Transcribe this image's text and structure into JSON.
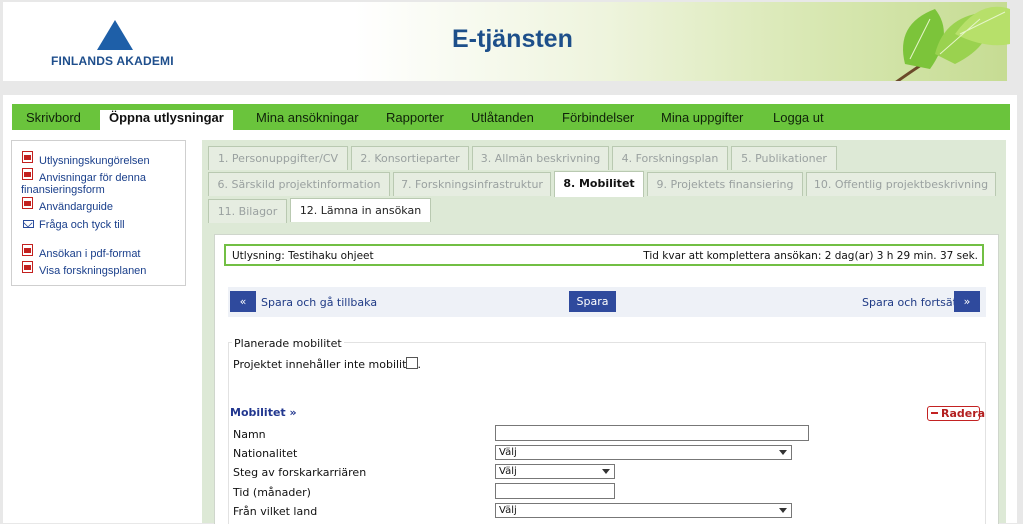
{
  "header": {
    "logo_text": "FINLANDS AKADEMI",
    "app_title": "E-tjänsten"
  },
  "nav": {
    "items": [
      {
        "label": "Skrivbord"
      },
      {
        "label": "Öppna utlysningar"
      },
      {
        "label": "Mina ansökningar"
      },
      {
        "label": "Rapporter"
      },
      {
        "label": "Utlåtanden"
      },
      {
        "label": "Förbindelser"
      },
      {
        "label": "Mina uppgifter"
      },
      {
        "label": "Logga ut"
      }
    ],
    "active_index": 1
  },
  "sidebar": {
    "links": [
      {
        "label": "Utlysningskungörelsen",
        "icon": "pdf-icon"
      },
      {
        "label": "Anvisningar för denna",
        "label2": "finansieringsform",
        "icon": "pdf-icon"
      },
      {
        "label": "Användarguide",
        "icon": "pdf-icon"
      },
      {
        "label": "Fråga och tyck till",
        "icon": "mail-icon"
      },
      {
        "label": "Ansökan i pdf-format",
        "icon": "pdf-icon"
      },
      {
        "label": "Visa forskningsplanen",
        "icon": "pdf-icon"
      }
    ]
  },
  "tabs": [
    {
      "label": "1. Personuppgifter/CV"
    },
    {
      "label": "2. Konsortieparter"
    },
    {
      "label": "3. Allmän beskrivning"
    },
    {
      "label": "4. Forskningsplan"
    },
    {
      "label": "5. Publikationer"
    },
    {
      "label": "6. Särskild projektinformation"
    },
    {
      "label": "7. Forskningsinfrastruktur"
    },
    {
      "label": "8. Mobilitet"
    },
    {
      "label": "9. Projektets finansiering"
    },
    {
      "label": "10. Offentlig projektbeskrivning"
    },
    {
      "label": "11. Bilagor"
    },
    {
      "label": "12. Lämna in ansökan"
    }
  ],
  "active_tab": "8. Mobilitet",
  "info": {
    "call": "Utlysning: Testihaku ohjeet",
    "time_left": "Tid kvar att komplettera ansökan: 2 dag(ar) 3 h 29 min. 37 sek."
  },
  "actions": {
    "back_symbol": "«",
    "back_label": "Spara och gå tillbaka",
    "save_label": "Spara",
    "next_label": "Spara och fortsätt",
    "next_symbol": "»"
  },
  "mobility": {
    "planned_heading": "Planerade mobilitet",
    "no_mobility_label": "Projektet innehåller inte mobilitet.",
    "section_title": "Mobilitet »",
    "delete_label": "Radera",
    "fields": [
      {
        "label": "Namn",
        "type": "text",
        "value": ""
      },
      {
        "label": "Nationalitet",
        "type": "select",
        "value": "Välj"
      },
      {
        "label": "Steg av forskarkarriären",
        "type": "select",
        "value": "Välj"
      },
      {
        "label": "Tid (månader)",
        "type": "text",
        "value": ""
      },
      {
        "label": "Från vilket land",
        "type": "select",
        "value": "Välj"
      }
    ]
  },
  "colors": {
    "nav_green": "#6ac43c",
    "link_blue": "#1a3f8b",
    "button_blue": "#2f4a9d",
    "delete_red": "#c32222"
  }
}
